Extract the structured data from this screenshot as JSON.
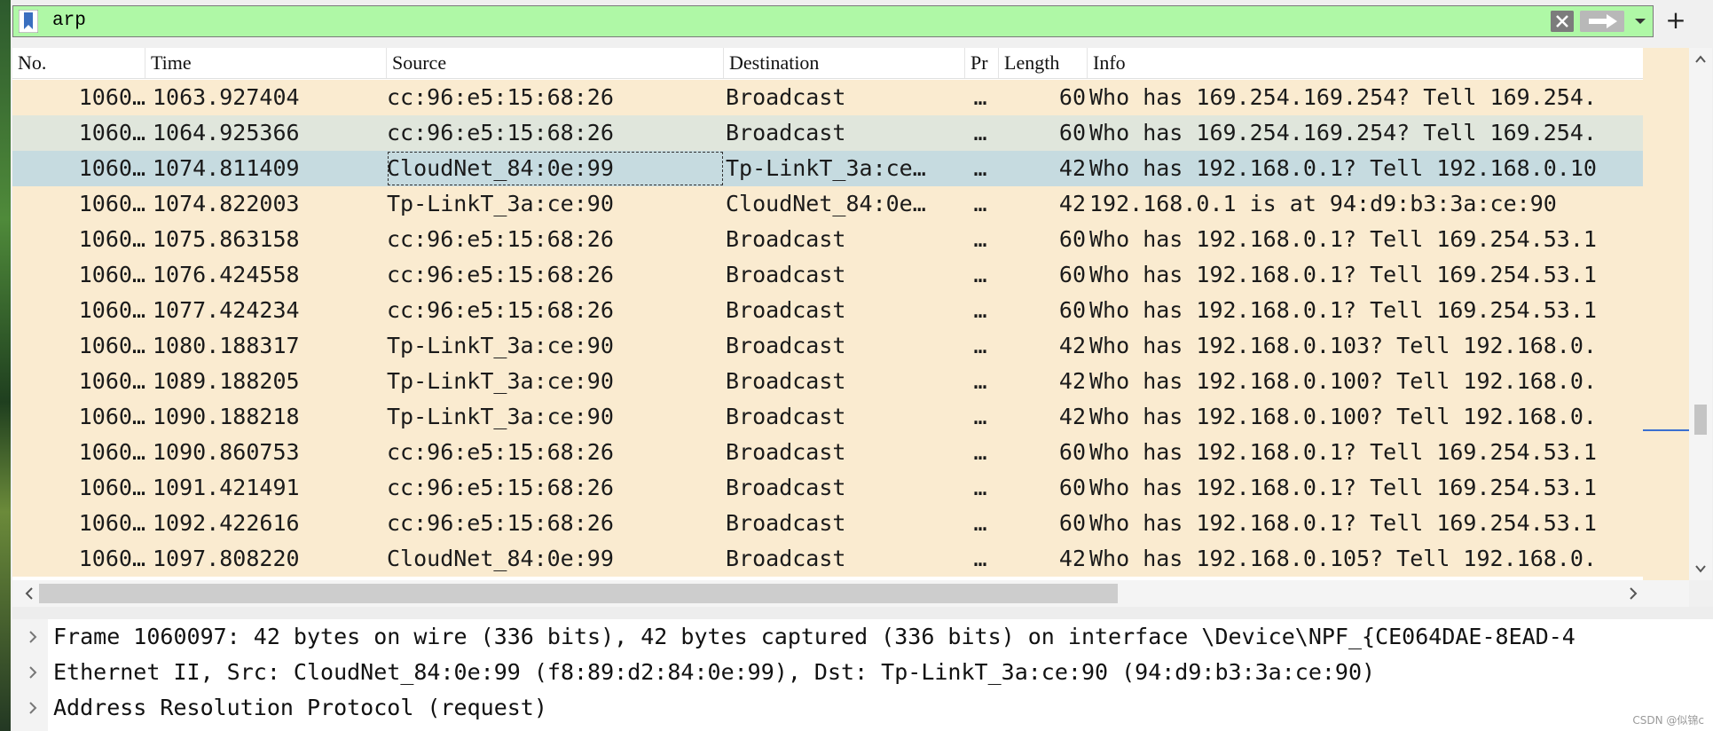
{
  "filter": {
    "value": "arp",
    "bookmark_icon": "bookmark-icon",
    "clear_icon": "clear-icon",
    "apply_icon": "arrow-right-icon",
    "dropdown_icon": "chevron-down-icon",
    "add_label": "+",
    "bg_color": "#aff8a6"
  },
  "columns": [
    "No.",
    "Time",
    "Source",
    "Destination",
    "Pr",
    "Length",
    "Info"
  ],
  "rows": [
    {
      "no": "1060…",
      "time": "1063.927404",
      "src": "cc:96:e5:15:68:26",
      "dst": "Broadcast",
      "pr": "…",
      "len": "60",
      "info": "Who has 169.254.169.254? Tell 169.254.",
      "bg": "#faebd0"
    },
    {
      "no": "1060…",
      "time": "1064.925366",
      "src": "cc:96:e5:15:68:26",
      "dst": "Broadcast",
      "pr": "…",
      "len": "60",
      "info": "Who has 169.254.169.254? Tell 169.254.",
      "bg": "#e0e6dc"
    },
    {
      "no": "1060…",
      "time": "1074.811409",
      "src": "CloudNet_84:0e:99",
      "dst": "Tp-LinkT_3a:ce…",
      "pr": "…",
      "len": "42",
      "info": "Who has 192.168.0.1? Tell 192.168.0.10",
      "bg": "#c6dbe0"
    },
    {
      "no": "1060…",
      "time": "1074.822003",
      "src": "Tp-LinkT_3a:ce:90",
      "dst": "CloudNet_84:0e…",
      "pr": "…",
      "len": "42",
      "info": "192.168.0.1 is at 94:d9:b3:3a:ce:90",
      "bg": "#faebd0"
    },
    {
      "no": "1060…",
      "time": "1075.863158",
      "src": "cc:96:e5:15:68:26",
      "dst": "Broadcast",
      "pr": "…",
      "len": "60",
      "info": "Who has 192.168.0.1? Tell 169.254.53.1",
      "bg": "#faebd0"
    },
    {
      "no": "1060…",
      "time": "1076.424558",
      "src": "cc:96:e5:15:68:26",
      "dst": "Broadcast",
      "pr": "…",
      "len": "60",
      "info": "Who has 192.168.0.1? Tell 169.254.53.1",
      "bg": "#faebd0"
    },
    {
      "no": "1060…",
      "time": "1077.424234",
      "src": "cc:96:e5:15:68:26",
      "dst": "Broadcast",
      "pr": "…",
      "len": "60",
      "info": "Who has 192.168.0.1? Tell 169.254.53.1",
      "bg": "#faebd0"
    },
    {
      "no": "1060…",
      "time": "1080.188317",
      "src": "Tp-LinkT_3a:ce:90",
      "dst": "Broadcast",
      "pr": "…",
      "len": "42",
      "info": "Who has 192.168.0.103? Tell 192.168.0.",
      "bg": "#faebd0"
    },
    {
      "no": "1060…",
      "time": "1089.188205",
      "src": "Tp-LinkT_3a:ce:90",
      "dst": "Broadcast",
      "pr": "…",
      "len": "42",
      "info": "Who has 192.168.0.100? Tell 192.168.0.",
      "bg": "#faebd0"
    },
    {
      "no": "1060…",
      "time": "1090.188218",
      "src": "Tp-LinkT_3a:ce:90",
      "dst": "Broadcast",
      "pr": "…",
      "len": "42",
      "info": "Who has 192.168.0.100? Tell 192.168.0.",
      "bg": "#faebd0"
    },
    {
      "no": "1060…",
      "time": "1090.860753",
      "src": "cc:96:e5:15:68:26",
      "dst": "Broadcast",
      "pr": "…",
      "len": "60",
      "info": "Who has 192.168.0.1? Tell 169.254.53.1",
      "bg": "#faebd0"
    },
    {
      "no": "1060…",
      "time": "1091.421491",
      "src": "cc:96:e5:15:68:26",
      "dst": "Broadcast",
      "pr": "…",
      "len": "60",
      "info": "Who has 192.168.0.1? Tell 169.254.53.1",
      "bg": "#faebd0"
    },
    {
      "no": "1060…",
      "time": "1092.422616",
      "src": "cc:96:e5:15:68:26",
      "dst": "Broadcast",
      "pr": "…",
      "len": "60",
      "info": "Who has 192.168.0.1? Tell 169.254.53.1",
      "bg": "#faebd0"
    },
    {
      "no": "1060…",
      "time": "1097.808220",
      "src": "CloudNet_84:0e:99",
      "dst": "Broadcast",
      "pr": "…",
      "len": "42",
      "info": "Who has 192.168.0.105? Tell 192.168.0.",
      "bg": "#faebd0"
    }
  ],
  "details": [
    "Frame 1060097: 42 bytes on wire (336 bits), 42 bytes captured (336 bits) on interface \\Device\\NPF_{CE064DAE-8EAD-4",
    "Ethernet II, Src: CloudNet_84:0e:99 (f8:89:d2:84:0e:99), Dst: Tp-LinkT_3a:ce:90 (94:d9:b3:3a:ce:90)",
    "Address Resolution Protocol (request)"
  ],
  "scroll": {
    "up_icon": "chevron-up-icon",
    "down_icon": "chevron-down-icon",
    "left_icon": "chevron-left-icon",
    "right_icon": "chevron-right-icon"
  },
  "watermark": "CSDN @似锦c"
}
